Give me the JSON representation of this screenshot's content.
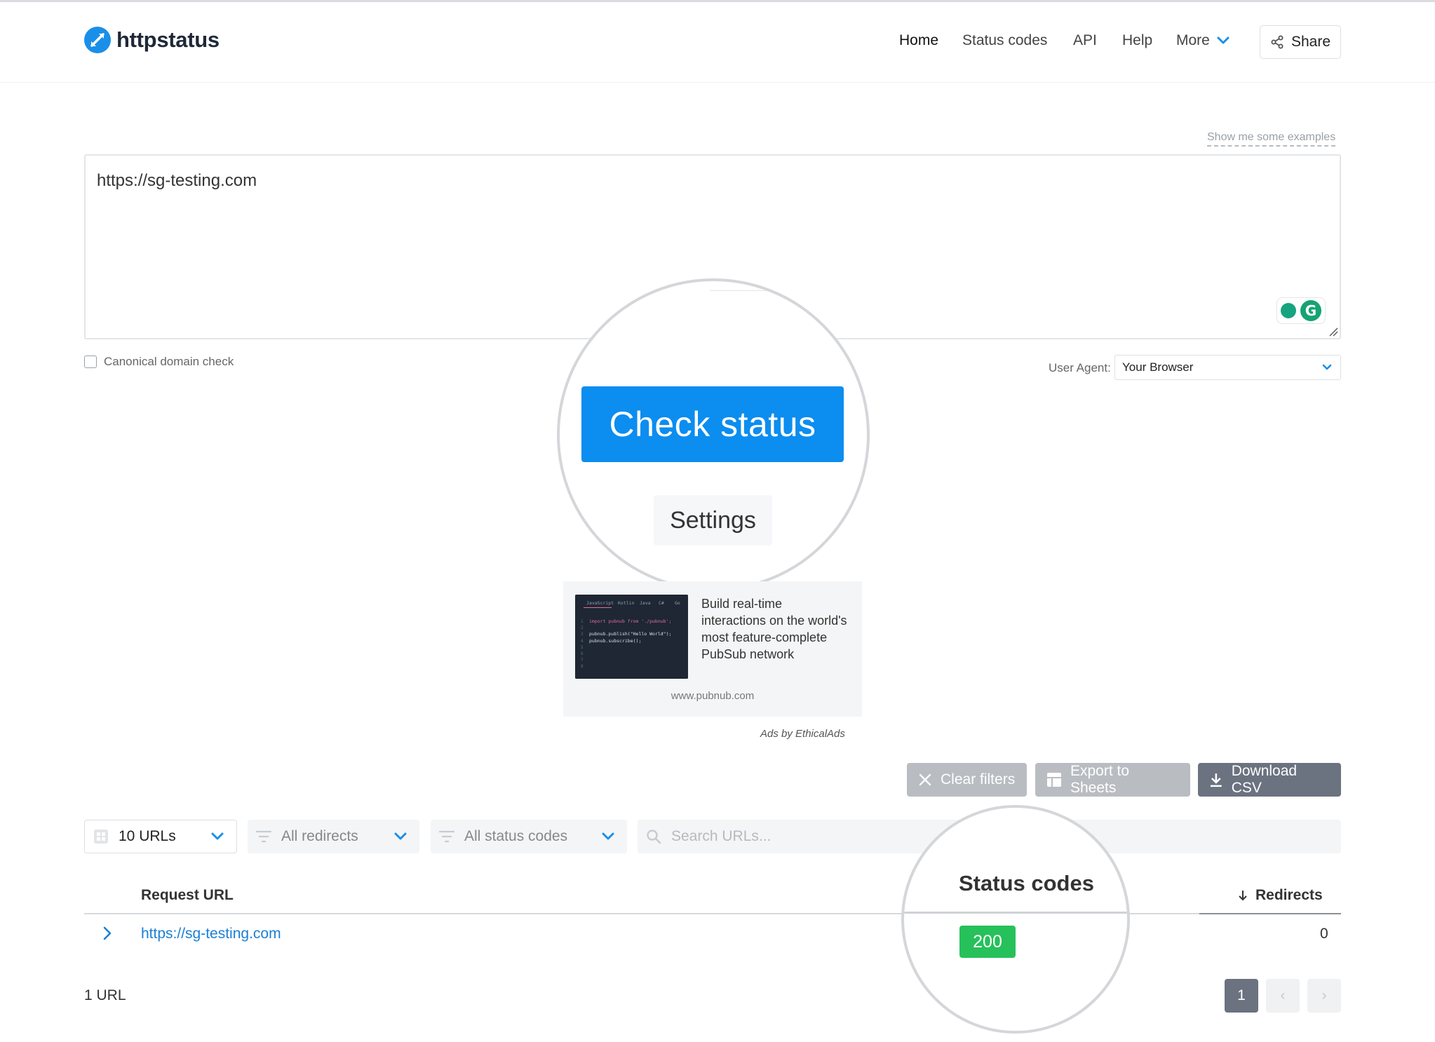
{
  "header": {
    "brand": "httpstatus",
    "nav": [
      {
        "label": "Home"
      },
      {
        "label": "Status codes"
      },
      {
        "label": "API"
      },
      {
        "label": "Help"
      },
      {
        "label": "More"
      }
    ],
    "share_label": "Share"
  },
  "input": {
    "examples_link": "Show me some examples",
    "url_value": "https://sg-testing.com",
    "canonical_label": "Canonical domain check",
    "canonical_checked": false,
    "user_agent_label": "User Agent:",
    "user_agent_value": "Your Browser"
  },
  "actions": {
    "check_label": "Check status",
    "settings_label": "Settings"
  },
  "ad": {
    "text": "Build real-time interactions on the world's most feature-complete PubSub network",
    "domain": "www.pubnub.com",
    "attribution": "Ads by EthicalAds",
    "code_tabs": [
      "JavaScript",
      "Kotlin",
      "Java",
      "C#",
      "Go"
    ],
    "code_lines": [
      "import pubnub from './pubnub';",
      "",
      "pubnub.publish(\"Hello World\");",
      "pubnub.subscribe();"
    ]
  },
  "toolbar": {
    "clear_filters": "Clear filters",
    "export_sheets": "Export to Sheets",
    "download_csv": "Download CSV"
  },
  "filters": {
    "urls": "10 URLs",
    "redirects": "All redirects",
    "status_codes": "All status codes",
    "search_placeholder": "Search URLs..."
  },
  "table": {
    "col_request_url": "Request URL",
    "col_status_codes": "Status codes",
    "col_redirects": "Redirects",
    "rows": [
      {
        "url": "https://sg-testing.com",
        "status": "200",
        "redirects": "0"
      }
    ]
  },
  "footer": {
    "count": "1 URL",
    "page": "1",
    "prev": "‹",
    "next": "›"
  },
  "colors": {
    "accent": "#0c8df0",
    "link": "#1a7fd6",
    "success": "#26c15a",
    "muted_button": "#b9bdc2",
    "dark_button": "#6b7280"
  }
}
